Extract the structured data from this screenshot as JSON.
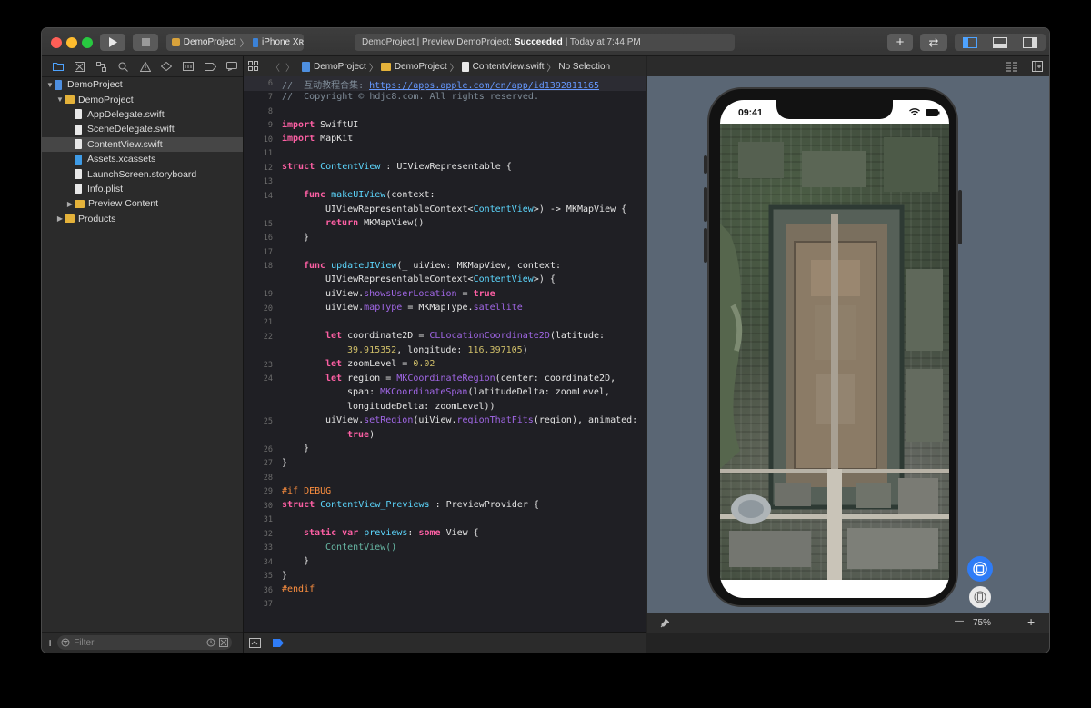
{
  "titlebar": {
    "scheme_project": "DemoProject",
    "scheme_device": "iPhone Xʀ",
    "activity_prefix": "DemoProject | Preview DemoProject:",
    "activity_status": "Succeeded",
    "activity_time": "| Today at 7:44 PM",
    "add_icon": "+",
    "swap_icon": "⇄"
  },
  "navigator": {
    "tree": [
      {
        "label": "DemoProject",
        "icon": "project-icon",
        "depth": 0,
        "expanded": true
      },
      {
        "label": "DemoProject",
        "icon": "folder-icon",
        "depth": 1,
        "expanded": true
      },
      {
        "label": "AppDelegate.swift",
        "icon": "swift-file-icon",
        "depth": 2
      },
      {
        "label": "SceneDelegate.swift",
        "icon": "swift-file-icon",
        "depth": 2
      },
      {
        "label": "ContentView.swift",
        "icon": "swift-file-icon",
        "depth": 2,
        "selected": true
      },
      {
        "label": "Assets.xcassets",
        "icon": "asset-catalog-icon",
        "depth": 2
      },
      {
        "label": "LaunchScreen.storyboard",
        "icon": "storyboard-icon",
        "depth": 2
      },
      {
        "label": "Info.plist",
        "icon": "plist-icon",
        "depth": 2
      },
      {
        "label": "Preview Content",
        "icon": "folder-icon",
        "depth": 2,
        "expanded": false
      },
      {
        "label": "Products",
        "icon": "folder-icon",
        "depth": 1,
        "expanded": false
      }
    ],
    "filter_placeholder": "Filter"
  },
  "jumpbar": {
    "crumbs": [
      "DemoProject",
      "DemoProject",
      "ContentView.swift",
      "No Selection"
    ]
  },
  "code": {
    "lines": [
      {
        "n": "6",
        "parts": [
          {
            "t": "//  互动教程合集: ",
            "c": "cmt"
          },
          {
            "t": "https://apps.apple.com/cn/app/id1392811165",
            "c": "ur"
          }
        ]
      },
      {
        "n": "7",
        "parts": [
          {
            "t": "//  Copyright © hdjc8.com. All rights reserved.",
            "c": "cmt"
          }
        ]
      },
      {
        "n": "8",
        "parts": []
      },
      {
        "n": "9",
        "parts": [
          {
            "t": "import",
            "c": "kw"
          },
          {
            "t": " SwiftUI",
            "c": ""
          }
        ]
      },
      {
        "n": "10",
        "parts": [
          {
            "t": "import",
            "c": "kw"
          },
          {
            "t": " MapKit",
            "c": ""
          }
        ]
      },
      {
        "n": "11",
        "parts": []
      },
      {
        "n": "12",
        "parts": [
          {
            "t": "struct",
            "c": "kw"
          },
          {
            "t": " ContentView",
            "c": "ty"
          },
          {
            "t": " : UIViewRepresentable {",
            "c": ""
          }
        ]
      },
      {
        "n": "13",
        "parts": []
      },
      {
        "n": "14",
        "ind": 1,
        "parts": [
          {
            "t": "func",
            "c": "kw"
          },
          {
            "t": " makeUIView",
            "c": "ty"
          },
          {
            "t": "(context:",
            "c": ""
          }
        ]
      },
      {
        "n": "",
        "ind": 2,
        "parts": [
          {
            "t": "UIViewRepresentableContext<",
            "c": ""
          },
          {
            "t": "ContentView",
            "c": "ty"
          },
          {
            "t": ">) -> MKMapView {",
            "c": ""
          }
        ]
      },
      {
        "n": "15",
        "ind": 2,
        "parts": [
          {
            "t": "return",
            "c": "kw"
          },
          {
            "t": " MKMapView()",
            "c": ""
          }
        ]
      },
      {
        "n": "16",
        "ind": 1,
        "parts": [
          {
            "t": "}",
            "c": ""
          }
        ]
      },
      {
        "n": "17",
        "parts": []
      },
      {
        "n": "18",
        "ind": 1,
        "parts": [
          {
            "t": "func",
            "c": "kw"
          },
          {
            "t": " updateUIView",
            "c": "ty"
          },
          {
            "t": "(_ uiView: MKMapView, context:",
            "c": ""
          }
        ]
      },
      {
        "n": "",
        "ind": 2,
        "parts": [
          {
            "t": "UIViewRepresentableContext<",
            "c": ""
          },
          {
            "t": "ContentView",
            "c": "ty"
          },
          {
            "t": ">) {",
            "c": ""
          }
        ]
      },
      {
        "n": "19",
        "ind": 2,
        "parts": [
          {
            "t": "uiView.",
            "c": ""
          },
          {
            "t": "showsUserLocation",
            "c": "pr"
          },
          {
            "t": " = ",
            "c": ""
          },
          {
            "t": "true",
            "c": "kw"
          }
        ]
      },
      {
        "n": "20",
        "ind": 2,
        "parts": [
          {
            "t": "uiView.",
            "c": ""
          },
          {
            "t": "mapType",
            "c": "pr"
          },
          {
            "t": " = MKMapType.",
            "c": ""
          },
          {
            "t": "satellite",
            "c": "pr"
          }
        ]
      },
      {
        "n": "21",
        "parts": []
      },
      {
        "n": "22",
        "ind": 2,
        "parts": [
          {
            "t": "let",
            "c": "kw"
          },
          {
            "t": " coordinate2D = ",
            "c": ""
          },
          {
            "t": "CLLocationCoordinate2D",
            "c": "pr"
          },
          {
            "t": "(latitude:",
            "c": ""
          }
        ]
      },
      {
        "n": "",
        "ind": 3,
        "parts": [
          {
            "t": "39.915352",
            "c": "nm"
          },
          {
            "t": ", longitude: ",
            "c": ""
          },
          {
            "t": "116.397105",
            "c": "nm"
          },
          {
            "t": ")",
            "c": ""
          }
        ]
      },
      {
        "n": "23",
        "ind": 2,
        "parts": [
          {
            "t": "let",
            "c": "kw"
          },
          {
            "t": " zoomLevel = ",
            "c": ""
          },
          {
            "t": "0.02",
            "c": "nm"
          }
        ]
      },
      {
        "n": "24",
        "ind": 2,
        "parts": [
          {
            "t": "let",
            "c": "kw"
          },
          {
            "t": " region = ",
            "c": ""
          },
          {
            "t": "MKCoordinateRegion",
            "c": "pr"
          },
          {
            "t": "(center: coordinate2D,",
            "c": ""
          }
        ]
      },
      {
        "n": "",
        "ind": 3,
        "parts": [
          {
            "t": "span: ",
            "c": ""
          },
          {
            "t": "MKCoordinateSpan",
            "c": "pr"
          },
          {
            "t": "(latitudeDelta: zoomLevel,",
            "c": ""
          }
        ]
      },
      {
        "n": "",
        "ind": 3,
        "parts": [
          {
            "t": "longitudeDelta: zoomLevel))",
            "c": ""
          }
        ]
      },
      {
        "n": "25",
        "ind": 2,
        "parts": [
          {
            "t": "uiView.",
            "c": ""
          },
          {
            "t": "setRegion",
            "c": "pr"
          },
          {
            "t": "(uiView.",
            "c": ""
          },
          {
            "t": "regionThatFits",
            "c": "pr"
          },
          {
            "t": "(region), animated:",
            "c": ""
          }
        ]
      },
      {
        "n": "",
        "ind": 3,
        "parts": [
          {
            "t": "true",
            "c": "kw"
          },
          {
            "t": ")",
            "c": ""
          }
        ]
      },
      {
        "n": "26",
        "ind": 1,
        "parts": [
          {
            "t": "}",
            "c": ""
          }
        ]
      },
      {
        "n": "27",
        "parts": [
          {
            "t": "}",
            "c": ""
          }
        ]
      },
      {
        "n": "28",
        "parts": []
      },
      {
        "n": "29",
        "parts": [
          {
            "t": "#if DEBUG",
            "c": "kw2"
          }
        ]
      },
      {
        "n": "30",
        "parts": [
          {
            "t": "struct",
            "c": "kw"
          },
          {
            "t": " ContentView_Previews",
            "c": "ty"
          },
          {
            "t": " : PreviewProvider {",
            "c": ""
          }
        ]
      },
      {
        "n": "31",
        "parts": []
      },
      {
        "n": "32",
        "ind": 1,
        "parts": [
          {
            "t": "static",
            "c": "kw"
          },
          {
            "t": " ",
            "c": ""
          },
          {
            "t": "var",
            "c": "kw"
          },
          {
            "t": " ",
            "c": ""
          },
          {
            "t": "previews",
            "c": "ty"
          },
          {
            "t": ": ",
            "c": ""
          },
          {
            "t": "some",
            "c": "kw"
          },
          {
            "t": " View {",
            "c": ""
          }
        ]
      },
      {
        "n": "33",
        "ind": 2,
        "parts": [
          {
            "t": "ContentView()",
            "c": "ty2"
          }
        ]
      },
      {
        "n": "34",
        "ind": 1,
        "parts": [
          {
            "t": "}",
            "c": ""
          }
        ]
      },
      {
        "n": "35",
        "parts": [
          {
            "t": "}",
            "c": ""
          }
        ]
      },
      {
        "n": "36",
        "parts": [
          {
            "t": "#endif",
            "c": "kw2"
          }
        ]
      },
      {
        "n": "37",
        "parts": []
      }
    ]
  },
  "canvas": {
    "status_time": "09:41",
    "zoom_level": "75%",
    "zoom_out": "—",
    "zoom_in": "+"
  },
  "colors": {
    "keyword": "#fc5fa3",
    "type": "#5dd8ff",
    "property": "#a167e6",
    "number": "#d0bf69",
    "accent": "#2f7cf6"
  }
}
